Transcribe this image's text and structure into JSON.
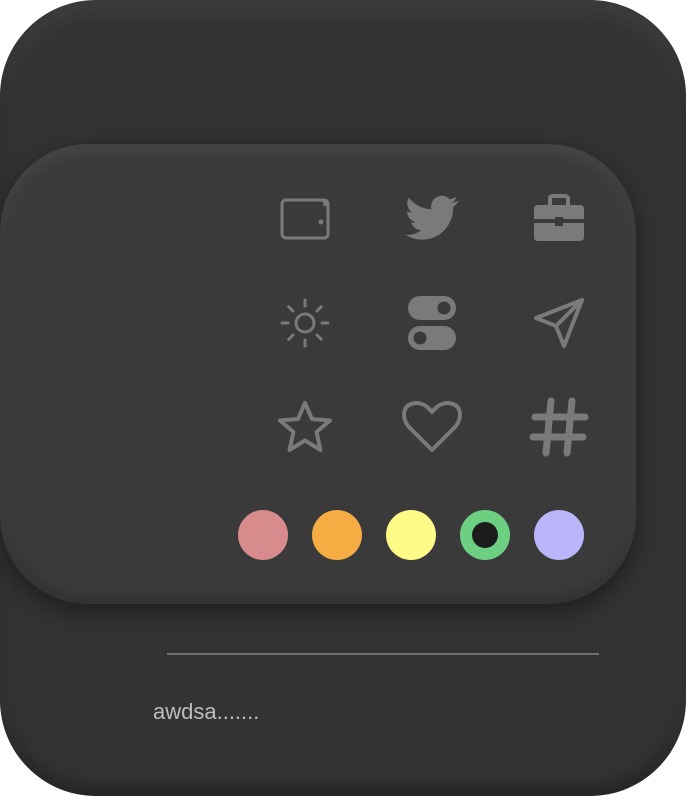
{
  "card": {
    "background": "#333333",
    "panel_background": "#3a3a3a",
    "icon_color": "#7a7a7a"
  },
  "icons": [
    {
      "name": "wallet-icon"
    },
    {
      "name": "twitter-icon"
    },
    {
      "name": "briefcase-icon"
    },
    {
      "name": "sun-icon"
    },
    {
      "name": "toggle-icon"
    },
    {
      "name": "send-icon"
    },
    {
      "name": "star-icon"
    },
    {
      "name": "heart-icon"
    },
    {
      "name": "hashtag-icon"
    }
  ],
  "color_swatches": [
    {
      "color": "#d88b8c",
      "selected": false
    },
    {
      "color": "#f5ad43",
      "selected": false
    },
    {
      "color": "#fdfa87",
      "selected": false
    },
    {
      "color": "#6dcf82",
      "selected": true
    },
    {
      "color": "#bab5f9",
      "selected": false
    }
  ],
  "note": {
    "text": "awdsa......."
  }
}
